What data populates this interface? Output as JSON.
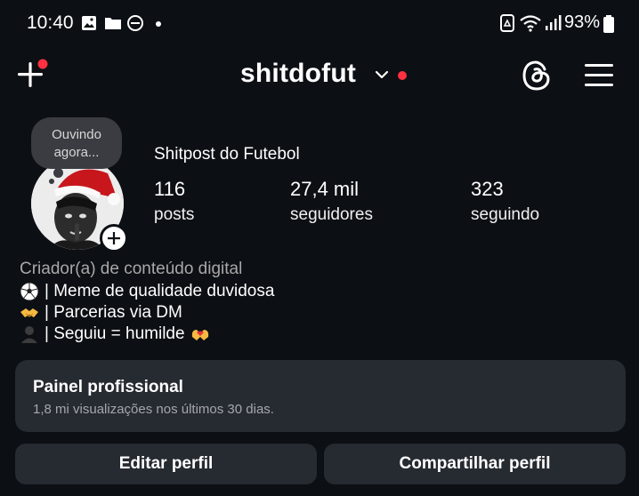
{
  "status_bar": {
    "time": "10:40",
    "left_icons": [
      "image-icon",
      "folder-icon",
      "dnd-icon",
      "dot-icon"
    ],
    "right_icons": [
      "recycle-icon",
      "wifi-icon",
      "signal-icon"
    ],
    "battery_text": "93%"
  },
  "header": {
    "username": "shitdofut",
    "plus_icon": "plus-icon",
    "threads_icon": "threads-icon",
    "menu_icon": "hamburger-icon",
    "accent": "#ff3040"
  },
  "profile": {
    "note": "Ouvindo agora...",
    "display_name": "Shitpost do Futebol",
    "stats": [
      {
        "value": "116",
        "label": "posts"
      },
      {
        "value": "27,4 mil",
        "label": "seguidores"
      },
      {
        "value": "323",
        "label": "seguindo"
      }
    ]
  },
  "bio": {
    "category": "Criador(a) de conteúdo digital",
    "lines": [
      {
        "icon": "soccer-ball-emoji",
        "text": "| Meme de qualidade duvidosa"
      },
      {
        "icon": "handshake-emoji",
        "text": "| Parcerias via DM"
      },
      {
        "icon": "person-silhouette-emoji",
        "text": "| Seguiu = humilde",
        "trailing_icon": "heart-hands-emoji"
      }
    ]
  },
  "dashboard": {
    "title": "Painel profissional",
    "subtitle": "1,8 mi visualizações nos últimos 30 dias."
  },
  "actions": {
    "edit": "Editar perfil",
    "share": "Compartilhar perfil"
  },
  "colors": {
    "background": "#0c0f14",
    "card": "#262a31",
    "muted_text": "#a8a8a8"
  }
}
